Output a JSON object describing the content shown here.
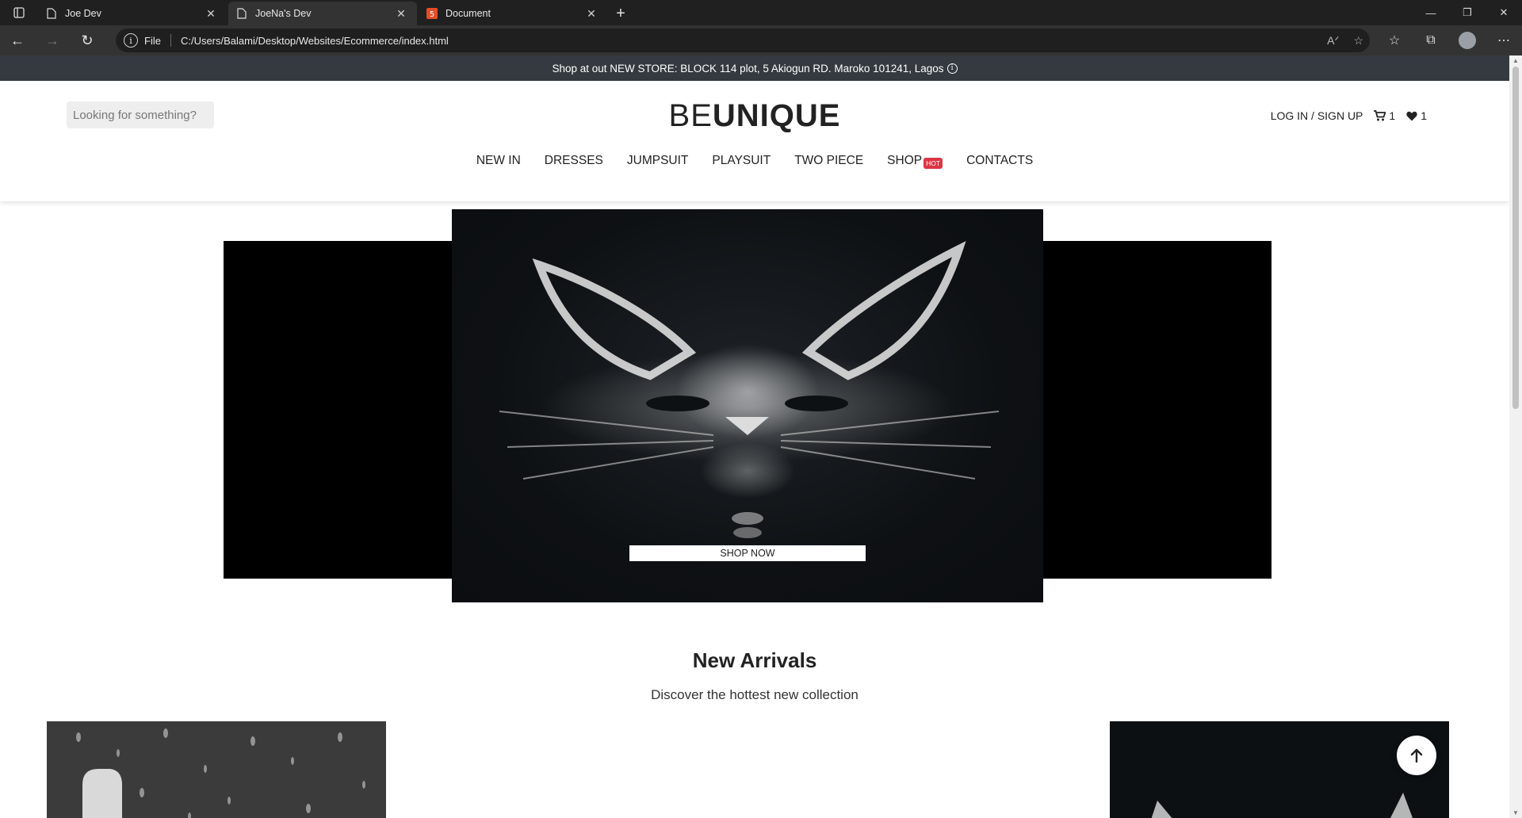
{
  "browser": {
    "tabs": [
      {
        "title": "Joe Dev",
        "icon": "page-icon",
        "active": false
      },
      {
        "title": "JoeNa's Dev",
        "icon": "page-icon",
        "active": true
      },
      {
        "title": "Document",
        "icon": "html5-icon",
        "active": false
      }
    ],
    "address": {
      "protocol_label": "File",
      "url": "C:/Users/Balami/Desktop/Websites/Ecommerce/index.html"
    }
  },
  "page": {
    "announcement": "Shop at out NEW STORE: BLOCK 114 plot, 5 Akiogun RD. Maroko 101241, Lagos",
    "search": {
      "placeholder": "Looking for something?"
    },
    "brand": {
      "light": "BE",
      "bold": "UNIQUE"
    },
    "account": {
      "login_label": "LOG IN / SIGN UP",
      "cart_count": "1",
      "wishlist_count": "1"
    },
    "nav": {
      "items": [
        "NEW IN",
        "DRESSES",
        "JUMPSUIT",
        "PLAYSUIT",
        "TWO PIECE",
        "SHOP",
        "CONTACTS"
      ],
      "hot_badge": "HOT"
    },
    "hero": {
      "cta": "SHOP NOW"
    },
    "new_arrivals": {
      "title": "New Arrivals",
      "subtitle": "Discover the hottest new collection"
    }
  },
  "colors": {
    "announcement_bg": "#343a40",
    "hot_badge": "#dc3545",
    "hero_bg": "#000000"
  }
}
